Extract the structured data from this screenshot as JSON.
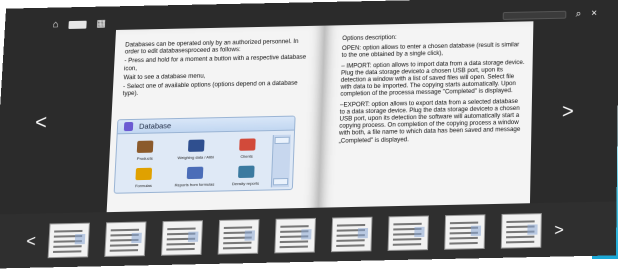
{
  "topbar": {
    "page_indicator": "",
    "status_text": "",
    "search_placeholder": ""
  },
  "left_page": {
    "paragraphs": [
      "Databases can be operated only by an authorized personnel. In order to edit databasesproceed as follows:",
      "- Press and hold for a moment a button with a respective database icon,",
      "Wait to see a database menu,",
      "- Select one of available options (options depend on a database type)."
    ],
    "database_panel": {
      "title": "Database",
      "items": [
        {
          "label": "Products",
          "color": "#8b5a2b"
        },
        {
          "label": "Weighing data / Alibi",
          "color": "#2f4f8f"
        },
        {
          "label": "Clients",
          "color": "#d24a3a"
        },
        {
          "label": "Formulas",
          "color": "#e0a100"
        },
        {
          "label": "Reports from formulas",
          "color": "#4b6db8"
        },
        {
          "label": "Density reports",
          "color": "#3b7aa0"
        }
      ]
    }
  },
  "right_page": {
    "paragraphs": [
      "Options description:",
      "OPEN: option allows to enter a chosen database (result is similar to the one obtained by a single click),",
      "– IMPORT: option allows to import data from a data storage device. Plug the data storage deviceto a chosen USB port, upon its detection a window with a list of saved files will open. Select file with data to be imported. The copying starts automatically. Upon completion of the processa message \"Completed\" is displayed.",
      "–EXPORT: option allows to export data from a selected database to a data storage device. Plug the data storage deviceto a chosen USB port, upon its detection the software will automatically start a copying process. On completion of the copying process a window with both, a file name to which data has been saved and message „Completed\" is displayed."
    ]
  },
  "nav": {
    "prev": "<",
    "next": ">"
  },
  "thumbnails": {
    "prev": "<",
    "next": ">",
    "count_shown": 9
  }
}
